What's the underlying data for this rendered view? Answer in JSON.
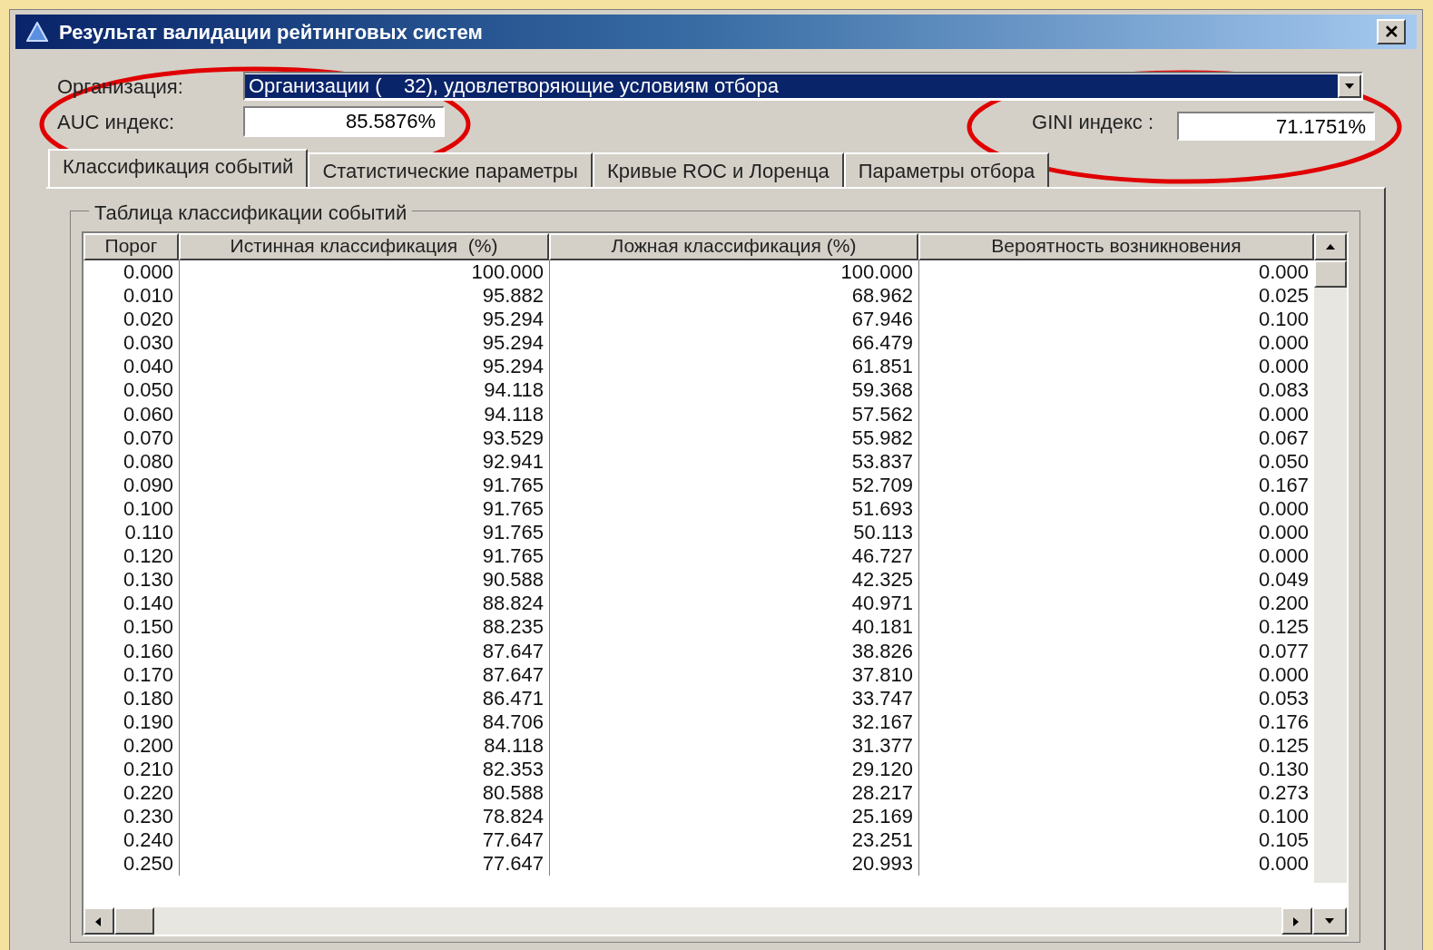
{
  "window": {
    "title": "Результат валидации рейтинговых систем",
    "close": "✕"
  },
  "organization": {
    "label": "Организация:",
    "value": "Организации (    32), удовлетворяющие условиям отбора"
  },
  "auc": {
    "label": "AUC индекс:",
    "value": "85.5876%"
  },
  "gini": {
    "label": "GINI индекс :",
    "value": "71.1751%"
  },
  "tabs": [
    {
      "label": "Классификация событий",
      "selected": true
    },
    {
      "label": "Статистические параметры",
      "selected": false
    },
    {
      "label": "Кривые ROC и Лоренца",
      "selected": false
    },
    {
      "label": "Параметры отбора",
      "selected": false
    }
  ],
  "group_title": "Таблица классификации событий",
  "table": {
    "columns": [
      "Порог",
      "Истинная классификация  (%)",
      "Ложная классификация (%)",
      "Вероятность возникновения"
    ],
    "rows": [
      [
        "0.000",
        "100.000",
        "100.000",
        "0.000"
      ],
      [
        "0.010",
        "95.882",
        "68.962",
        "0.025"
      ],
      [
        "0.020",
        "95.294",
        "67.946",
        "0.100"
      ],
      [
        "0.030",
        "95.294",
        "66.479",
        "0.000"
      ],
      [
        "0.040",
        "95.294",
        "61.851",
        "0.000"
      ],
      [
        "0.050",
        "94.118",
        "59.368",
        "0.083"
      ],
      [
        "0.060",
        "94.118",
        "57.562",
        "0.000"
      ],
      [
        "0.070",
        "93.529",
        "55.982",
        "0.067"
      ],
      [
        "0.080",
        "92.941",
        "53.837",
        "0.050"
      ],
      [
        "0.090",
        "91.765",
        "52.709",
        "0.167"
      ],
      [
        "0.100",
        "91.765",
        "51.693",
        "0.000"
      ],
      [
        "0.110",
        "91.765",
        "50.113",
        "0.000"
      ],
      [
        "0.120",
        "91.765",
        "46.727",
        "0.000"
      ],
      [
        "0.130",
        "90.588",
        "42.325",
        "0.049"
      ],
      [
        "0.140",
        "88.824",
        "40.971",
        "0.200"
      ],
      [
        "0.150",
        "88.235",
        "40.181",
        "0.125"
      ],
      [
        "0.160",
        "87.647",
        "38.826",
        "0.077"
      ],
      [
        "0.170",
        "87.647",
        "37.810",
        "0.000"
      ],
      [
        "0.180",
        "86.471",
        "33.747",
        "0.053"
      ],
      [
        "0.190",
        "84.706",
        "32.167",
        "0.176"
      ],
      [
        "0.200",
        "84.118",
        "31.377",
        "0.125"
      ],
      [
        "0.210",
        "82.353",
        "29.120",
        "0.130"
      ],
      [
        "0.220",
        "80.588",
        "28.217",
        "0.273"
      ],
      [
        "0.230",
        "78.824",
        "25.169",
        "0.100"
      ],
      [
        "0.240",
        "77.647",
        "23.251",
        "0.105"
      ],
      [
        "0.250",
        "77.647",
        "20.993",
        "0.000"
      ]
    ]
  }
}
